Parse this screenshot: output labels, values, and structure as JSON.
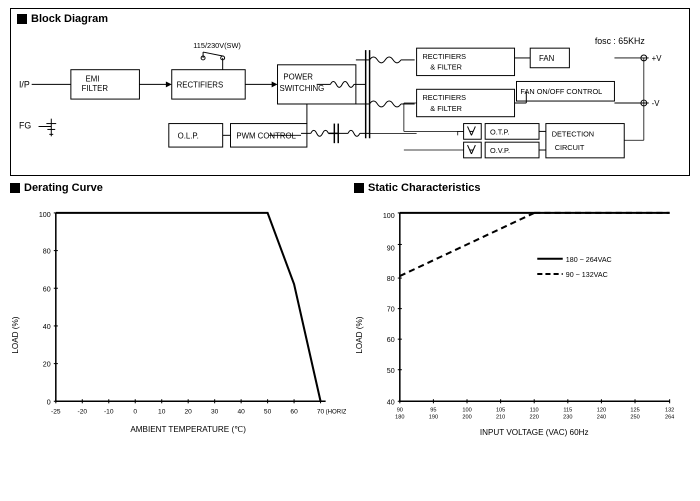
{
  "blockDiagram": {
    "title": "Block Diagram",
    "fosc": "fosc : 65KHz",
    "components": [
      "I/P",
      "FG",
      "EMI FILTER",
      "RECTIFIERS",
      "POWER SWITCHING",
      "RECTIFIERS & FILTER",
      "FAN",
      "RECTIFIERS & FILTER",
      "FAN ON/OFF CONTROL",
      "+V",
      "-V",
      "O.T.P.",
      "O.V.P.",
      "DETECTION CIRCUIT",
      "PWM CONTROL",
      "O.L.P.",
      "115/230V(SW)"
    ]
  },
  "deratingCurve": {
    "title": "Derating Curve",
    "xLabel": "AMBIENT TEMPERATURE (℃)",
    "yLabel": "LOAD (%)",
    "xTicks": [
      "-25",
      "-20",
      "-10",
      "0",
      "10",
      "20",
      "30",
      "40",
      "50",
      "60",
      "70"
    ],
    "yTicks": [
      "0",
      "20",
      "40",
      "60",
      "80",
      "100"
    ],
    "note": "(HORIZONTAL)"
  },
  "staticChar": {
    "title": "Static Characteristics",
    "xLabel": "INPUT VOLTAGE (VAC) 60Hz",
    "yLabel": "LOAD (%)",
    "xTicks": [
      "90\n180",
      "95\n190",
      "100\n200",
      "105\n210",
      "110\n220",
      "115\n230",
      "120\n240",
      "125\n250",
      "132\n264"
    ],
    "yTicks": [
      "40",
      "50",
      "60",
      "70",
      "80",
      "90",
      "100"
    ],
    "legend": {
      "solid": "180 ~ 264VAC",
      "dashed": "90 ~ 132VAC"
    }
  }
}
